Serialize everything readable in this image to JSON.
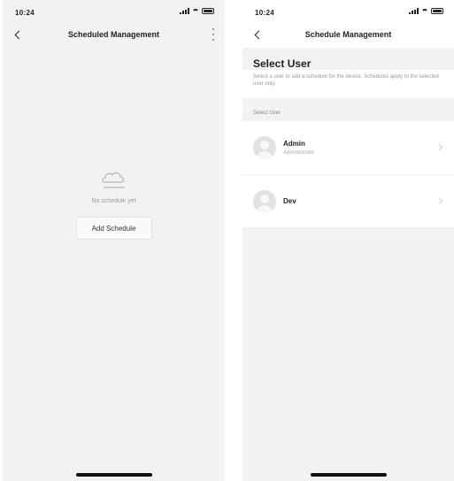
{
  "left": {
    "status": {
      "time": "10:24"
    },
    "nav": {
      "title": "Scheduled Management"
    },
    "empty": {
      "icon": "cloud-icon",
      "text": "No schedule yet",
      "add_button": "Add Schedule"
    }
  },
  "right": {
    "status": {
      "time": "10:24"
    },
    "nav": {
      "title": "Schedule Management"
    },
    "select_user": {
      "title": "Select User",
      "description": "Select a user to add a schedule for the device. Schedules apply to the selected user only."
    },
    "section_header": "Select User",
    "users": [
      {
        "name": "Admin",
        "subtitle": "Administrator"
      },
      {
        "name": "Dev",
        "subtitle": ""
      }
    ]
  },
  "colors": {
    "background": "#f2f2f4",
    "card": "#ffffff",
    "home_indicator": "#111111"
  }
}
